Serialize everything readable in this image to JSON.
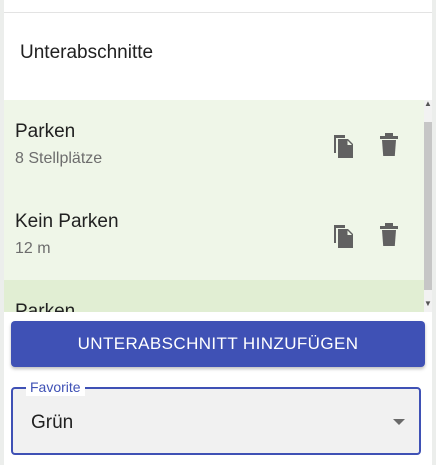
{
  "section": {
    "title": "Unterabschnitte"
  },
  "subsections": [
    {
      "title": "Parken",
      "detail": "8 Stellplätze",
      "selected": false
    },
    {
      "title": "Kein Parken",
      "detail": "12 m",
      "selected": false
    },
    {
      "title": "Parken",
      "detail": "",
      "selected": true
    }
  ],
  "icons": {
    "copy": "content-copy-icon",
    "delete": "delete-icon"
  },
  "add_button": {
    "label": "UNTERABSCHNITT HINZUFÜGEN"
  },
  "favorite_field": {
    "label": "Favorite",
    "value": "Grün"
  },
  "colors": {
    "primary": "#3f51b5",
    "item_bg": "#eff6e8",
    "item_selected_bg": "#e1eed3",
    "icon": "#616161"
  }
}
